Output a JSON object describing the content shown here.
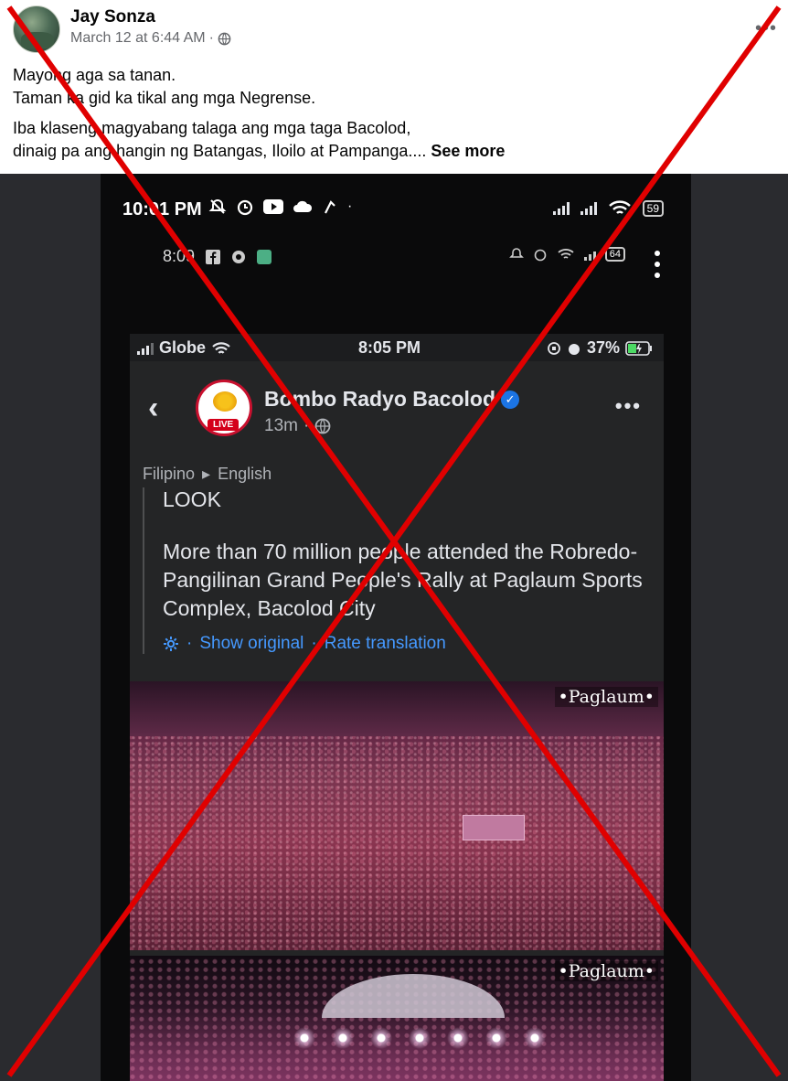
{
  "post": {
    "author": "Jay Sonza",
    "timestamp": "March 12 at 6:44 AM",
    "separator": "·",
    "more_label": "•••",
    "line1": "Mayong aga sa tanan.",
    "line2": "Taman ka gid ka tikal ang mga Negrense.",
    "line3": "Iba klaseng magyabang talaga ang mga taga Bacolod,",
    "line4": "dinaig pa ang hangin ng Batangas, Iloilo at Pampanga....",
    "see_more": "See more"
  },
  "phone_status": {
    "time": "10:01 PM",
    "battery": "59",
    "notif_time": "8:09",
    "notif_battery": "64"
  },
  "inner_screen": {
    "carrier": "Globe",
    "time": "8:05 PM",
    "battery_percent": "37%",
    "page_name": "Bombo Radyo Bacolod",
    "live_badge": "LIVE",
    "age": "13m",
    "dot": "·",
    "lang_from": "Filipino",
    "lang_arrow": "▸",
    "lang_to": "English",
    "look": "LOOK",
    "body": "More than 70 million people attended the Robredo-Pangilinan Grand People's Rally at Paglaum Sports Complex, Bacolod City",
    "show_original": "Show original",
    "rate_translation": "Rate translation",
    "photo_brand_1": "•Paglaum•",
    "photo_brand_2": "•Paglaum•"
  },
  "colors": {
    "fb_link": "#4599ff",
    "overlay_x": "#e00000",
    "verified": "#1b74e4"
  },
  "icons": [
    "globe-icon",
    "more-icon",
    "mute-icon",
    "alarm-icon",
    "youtube-icon",
    "cloud-icon",
    "wifi-icon",
    "signal-icon",
    "battery-icon",
    "back-icon",
    "verified-icon",
    "settings-icon"
  ]
}
